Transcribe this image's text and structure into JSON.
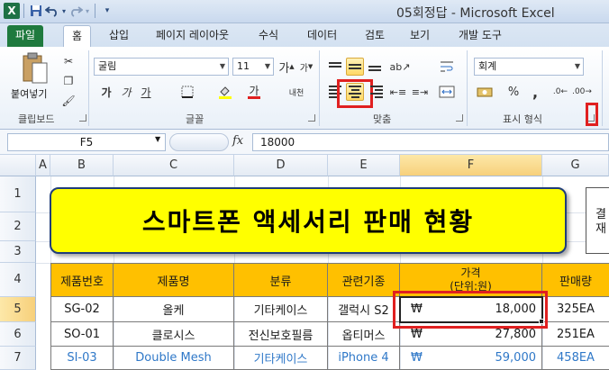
{
  "window": {
    "title": "05회정답  -  Microsoft Excel"
  },
  "quick_access": {
    "logo": "X",
    "save_icon": "save-icon",
    "undo_icon": "undo-icon",
    "redo_icon": "redo-icon"
  },
  "tabs": [
    {
      "label": "파일"
    },
    {
      "label": "홈"
    },
    {
      "label": "삽입"
    },
    {
      "label": "페이지 레이아웃"
    },
    {
      "label": "수식"
    },
    {
      "label": "데이터"
    },
    {
      "label": "검토"
    },
    {
      "label": "보기"
    },
    {
      "label": "개발 도구"
    }
  ],
  "ribbon": {
    "clipboard": {
      "label": "클립보드",
      "paste_label": "붙여넣기"
    },
    "font": {
      "label": "글꼴",
      "font_name": "굴림",
      "font_size": "11",
      "bold": "가",
      "italic": "가",
      "underline": "가",
      "grow": "가",
      "shrink": "가",
      "font_color_glyph": "가",
      "phonetic": "내천"
    },
    "alignment": {
      "label": "맞춤"
    },
    "number": {
      "label": "표시 형식",
      "format": "회계",
      "percent": "%",
      "comma": ","
    }
  },
  "formula_bar": {
    "name_box": "F5",
    "fx": "fx",
    "value": "18000"
  },
  "columns": [
    "A",
    "B",
    "C",
    "D",
    "E",
    "F",
    "G"
  ],
  "rows": [
    "1",
    "2",
    "3",
    "4",
    "5",
    "6",
    "7"
  ],
  "sheet": {
    "banner_title": "스마트폰 액세서리 판매 현황",
    "side_box": {
      "line1": "결",
      "line2": "재"
    },
    "headers": [
      "제품번호",
      "제품명",
      "분류",
      "관련기종",
      "가격\n(단위:원)",
      "판매량"
    ],
    "rows": [
      {
        "id": "SG-02",
        "name": "올케",
        "category": "기타케이스",
        "model": "갤럭시 S2",
        "currency": "₩",
        "price": "18,000",
        "qty": "325EA",
        "highlight": false
      },
      {
        "id": "SO-01",
        "name": "클로시스",
        "category": "전신보호필름",
        "model": "옵티머스",
        "currency": "₩",
        "price": "27,800",
        "qty": "251EA",
        "highlight": false
      },
      {
        "id": "SI-03",
        "name": "Double Mesh",
        "category": "기타케이스",
        "model": "iPhone 4",
        "currency": "₩",
        "price": "59,000",
        "qty": "458EA",
        "highlight": true
      }
    ]
  },
  "colors": {
    "accent_red": "#e02020",
    "header_orange": "#ffc000",
    "banner_yellow": "#ffff00",
    "link_blue": "#2f78c8",
    "file_tab_green": "#1f7a3e"
  }
}
